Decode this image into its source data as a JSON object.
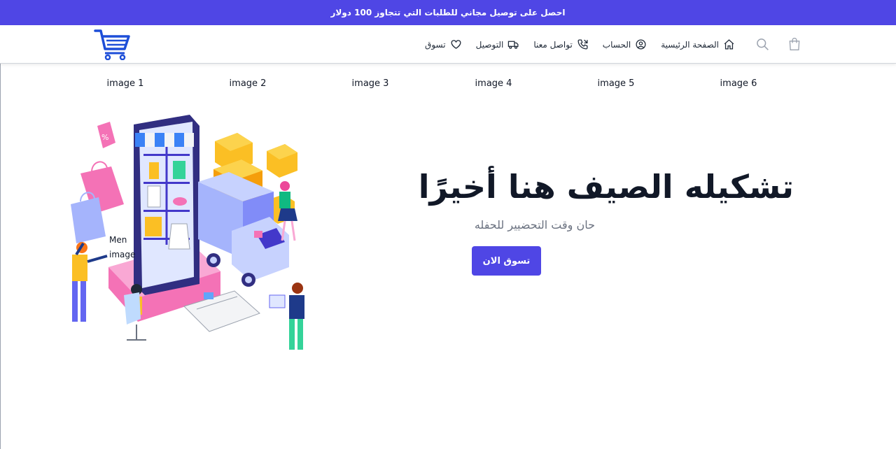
{
  "promo_bar": {
    "text": "احصل على توصيل مجاني للطلبات التي تتجاوز 100 دولار"
  },
  "nav": {
    "logo": "cart-logo",
    "links": [
      {
        "label": "الصفحة الرئيسية",
        "icon": "home-icon"
      },
      {
        "label": "الحساب",
        "icon": "user-circle-icon"
      },
      {
        "label": "تواصل معنا",
        "icon": "phone-icon"
      },
      {
        "label": "التوصيل",
        "icon": "truck-icon"
      },
      {
        "label": "تسوق",
        "icon": "heart-icon"
      }
    ],
    "search_icon": "search-icon",
    "bag_icon": "shopping-bag-icon"
  },
  "thumbnails": [
    "image 1",
    "image 2",
    "image 3",
    "image 4",
    "image 5",
    "image 6"
  ],
  "hero": {
    "title": "تشكيله الصيف هنا أخيرًا",
    "subtitle": "حان وقت التحضيير للحفله",
    "cta_label": "تسوق الان",
    "broken_image_alt": "Men image"
  },
  "colors": {
    "accent": "#4f46e5",
    "logo_blue": "#1d4ed8",
    "text_dark": "#111827",
    "text_muted": "#6b7280"
  }
}
